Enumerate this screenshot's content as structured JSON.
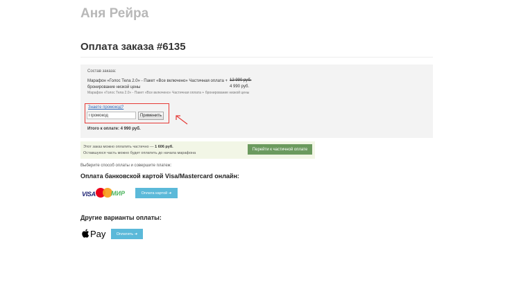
{
  "header": {
    "author": "Аня Рейра",
    "page_title": "Оплата заказа #6135"
  },
  "order": {
    "label": "Состав заказа:",
    "item_name": "Марафон «Голос Тела 2.0» - Пакет «Все включено» Частичная оплата + бронирование низкой цены",
    "price_old": "12 990 руб.",
    "price_new": "4 990 руб.",
    "item_desc": "Марафон «Голос Тела 2.0» - Пакет «Все включено» Частичная оплата + бронирование низкой цены",
    "promo_link": "Знаете промокод?",
    "promo_placeholder": "Промокод",
    "promo_apply": "Применить",
    "total": "Итого к оплате: 4 990 руб."
  },
  "partial": {
    "line1_prefix": "Этот заказ можно оплатить частично — ",
    "line1_amount": "1 606 руб.",
    "line2": "Оставшуюся часть можно будет оплатить до начала марафона",
    "button": "Перейти к частичной оплате"
  },
  "payment": {
    "choose_text": "Выберите способ оплаты и совершите платеж:",
    "card_title": "Оплата банковской картой Visa/Mastercard онлайн:",
    "visa_text": "VISA",
    "mir_text": "МИР",
    "card_button": "Оплата картой ➜",
    "other_title": "Другие варианты оплаты:",
    "apple_pay_text": "Pay",
    "other_button": "Оплатить ➜"
  },
  "colors": {
    "accent_green": "#6b9a5e",
    "accent_blue": "#5bb9d9",
    "highlight_red": "#e53935"
  }
}
